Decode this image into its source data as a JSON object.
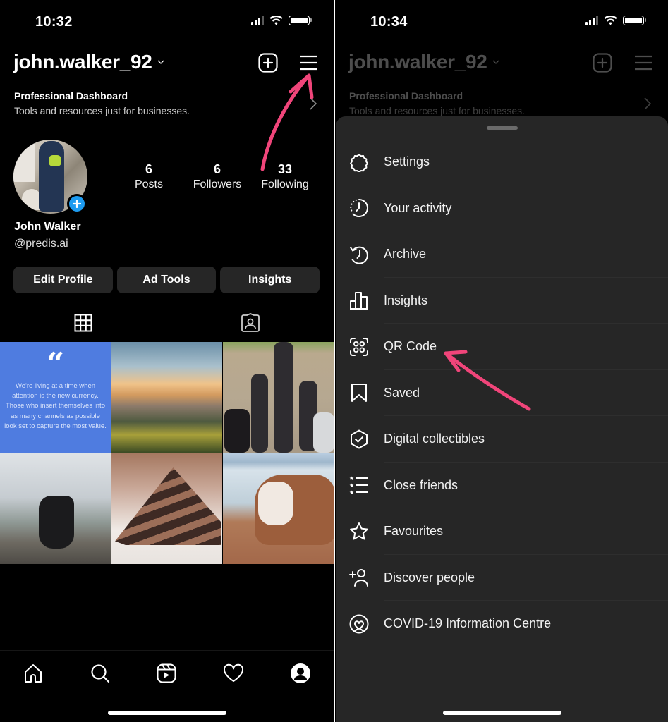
{
  "left_screen": {
    "status_bar": {
      "time": "10:32"
    },
    "header": {
      "username": "john.walker_92"
    },
    "pro_dashboard": {
      "title": "Professional Dashboard",
      "subtitle": "Tools and resources just for businesses."
    },
    "profile": {
      "display_name": "John Walker",
      "handle": "@predis.ai",
      "stats": [
        {
          "value": "6",
          "label": "Posts"
        },
        {
          "value": "6",
          "label": "Followers"
        },
        {
          "value": "33",
          "label": "Following"
        }
      ]
    },
    "actions": [
      "Edit Profile",
      "Ad Tools",
      "Insights"
    ],
    "tabs": [
      {
        "icon": "grid-icon",
        "active": true
      },
      {
        "icon": "tagged-icon",
        "active": false
      }
    ],
    "posts": [
      {
        "type": "quote",
        "text": "We're living at a time when attention is the new currency. Those who insert themselves into as many channels as possible look set to capture the most value."
      },
      {
        "type": "photo",
        "subject": "sunset over coastline"
      },
      {
        "type": "photo",
        "subject": "shadows of person walking dogs"
      },
      {
        "type": "photo",
        "subject": "motorcycles on misty road"
      },
      {
        "type": "photo",
        "subject": "slice of chocolate cake"
      },
      {
        "type": "photo",
        "subject": "bulldog on wooden deck"
      }
    ],
    "bottom_nav": [
      "home-icon",
      "search-icon",
      "reels-icon",
      "heart-icon",
      "profile-icon"
    ]
  },
  "right_screen": {
    "status_bar": {
      "time": "10:34"
    },
    "header": {
      "username": "john.walker_92"
    },
    "pro_dashboard": {
      "title": "Professional Dashboard",
      "subtitle": "Tools and resources just for businesses."
    },
    "menu": [
      {
        "icon": "settings-icon",
        "label": "Settings"
      },
      {
        "icon": "activity-icon",
        "label": "Your activity"
      },
      {
        "icon": "archive-icon",
        "label": "Archive"
      },
      {
        "icon": "insights-icon",
        "label": "Insights"
      },
      {
        "icon": "qr-code-icon",
        "label": "QR Code"
      },
      {
        "icon": "bookmark-icon",
        "label": "Saved"
      },
      {
        "icon": "digital-collectibles-icon",
        "label": "Digital collectibles"
      },
      {
        "icon": "close-friends-icon",
        "label": "Close friends"
      },
      {
        "icon": "star-icon",
        "label": "Favourites"
      },
      {
        "icon": "add-person-icon",
        "label": "Discover people"
      },
      {
        "icon": "covid-info-icon",
        "label": "COVID-19 Information Centre"
      }
    ]
  },
  "colors": {
    "annotation_arrow": "#f0457a",
    "story_add_badge": "#1d9bf0",
    "sheet_background": "#262626",
    "button_background": "#262626",
    "quote_post_background": "#4f7ce0"
  }
}
